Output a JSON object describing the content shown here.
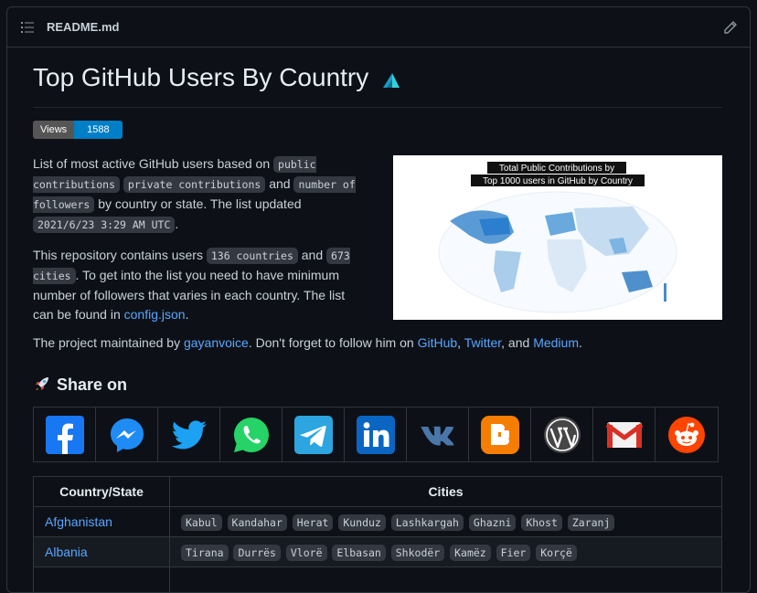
{
  "file": {
    "name": "README.md"
  },
  "readme": {
    "title": "Top GitHub Users By Country",
    "badge": {
      "label": "Views",
      "value": "1588"
    },
    "intro": {
      "t1": "List of most active GitHub users based on ",
      "c1": "public contributions",
      "c2": "private contributions",
      "t2": " and ",
      "c3": "number of followers",
      "t3": " by country or state. The list updated ",
      "c4": "2021/6/23 3:29 AM UTC",
      "t4": "."
    },
    "contains": {
      "t1": "This repository contains users ",
      "c1": "136 countries",
      "t2": " and ",
      "c2": "673 cities",
      "t3": ". To get into the list you need to have minimum number of followers that varies in each country. The list can be found in ",
      "link": "config.json",
      "t4": "."
    },
    "map": {
      "title_line1": "Total Public Contributions by",
      "title_line2": "Top 1000 users in GitHub by Country"
    },
    "maintained": {
      "t1": "The project maintained by ",
      "author": "gayanvoice",
      "t2": ". Don't forget to follow him on ",
      "github": "GitHub",
      "sep1": ", ",
      "twitter": "Twitter",
      "sep2": ", and ",
      "medium": "Medium",
      "t3": "."
    },
    "share": {
      "heading": "Share on",
      "icons": [
        "facebook-icon",
        "messenger-icon",
        "twitter-icon",
        "whatsapp-icon",
        "telegram-icon",
        "linkedin-icon",
        "vk-icon",
        "blogger-icon",
        "wordpress-icon",
        "gmail-icon",
        "reddit-icon"
      ]
    },
    "table": {
      "headers": [
        "Country/State",
        "Cities"
      ],
      "rows": [
        {
          "country": "Afghanistan",
          "cities": [
            "Kabul",
            "Kandahar",
            "Herat",
            "Kunduz",
            "Lashkargah",
            "Ghazni",
            "Khost",
            "Zaranj"
          ]
        },
        {
          "country": "Albania",
          "cities": [
            "Tirana",
            "Durrës",
            "Vlorë",
            "Elbasan",
            "Shkodër",
            "Kamëz",
            "Fier",
            "Korçë"
          ]
        }
      ]
    }
  },
  "colors": {
    "bg": "#0d1117",
    "border": "#30363d",
    "link": "#58a6ff",
    "badge_value": "#007ec6"
  }
}
